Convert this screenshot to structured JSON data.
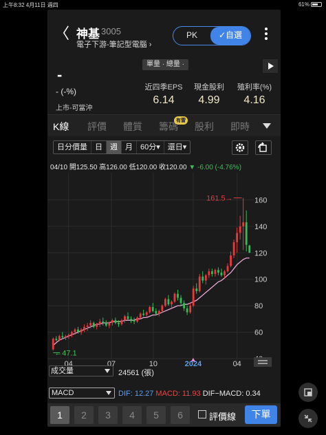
{
  "status": {
    "time_date": "上午8:32  4月11日 週四",
    "wifi_battery": "61%"
  },
  "header": {
    "back": "〈",
    "name": "神基",
    "code": "3005",
    "category": "電子下游-筆記型電腦 ›",
    "pk": "PK",
    "fav": "✓自選"
  },
  "quote": {
    "toggle": "單量 · 總量 ·",
    "price": "-",
    "change": "- (-%)",
    "market": "上市-可當沖",
    "stats": [
      {
        "label": "近四季EPS",
        "value": "6.14"
      },
      {
        "label": "現金股利",
        "value": "4.99"
      },
      {
        "label": "殖利率(%)",
        "value": "4.16"
      }
    ]
  },
  "tabs": {
    "items": [
      "K線",
      "評價",
      "體質",
      "籌碼",
      "股利",
      "即時"
    ],
    "badge": "有雷"
  },
  "toolbar": {
    "segments": [
      "日分價量",
      "日",
      "週",
      "月",
      "60分▾",
      "還日▾"
    ],
    "active": "週"
  },
  "ohlc": {
    "date": "04/10",
    "open": "開125.50",
    "high": "高126.00",
    "low": "低120.00",
    "close": "收120.00",
    "change": "▼ -6.00 (-4.76%)"
  },
  "chart_data": {
    "type": "candlestick",
    "y_ticks": [
      "160",
      "140",
      "120",
      "100",
      "80",
      "60",
      "40"
    ],
    "x_ticks": [
      "04",
      "07",
      "10",
      "2024",
      "04"
    ],
    "annot_high": "161.5",
    "annot_low": "47.1",
    "ylim": [
      40,
      168
    ],
    "candles": [
      [
        47,
        56,
        46,
        55
      ],
      [
        55,
        57,
        53,
        54
      ],
      [
        54,
        58,
        53,
        57
      ],
      [
        57,
        60,
        55,
        56
      ],
      [
        56,
        58,
        54,
        57
      ],
      [
        57,
        59,
        55,
        58
      ],
      [
        58,
        61,
        56,
        60
      ],
      [
        60,
        63,
        58,
        62
      ],
      [
        62,
        64,
        59,
        60
      ],
      [
        60,
        63,
        58,
        62
      ],
      [
        62,
        66,
        60,
        64
      ],
      [
        64,
        67,
        61,
        65
      ],
      [
        65,
        69,
        63,
        67
      ],
      [
        67,
        68,
        63,
        64
      ],
      [
        64,
        67,
        62,
        66
      ],
      [
        66,
        70,
        64,
        68
      ],
      [
        68,
        71,
        65,
        67
      ],
      [
        67,
        69,
        64,
        65
      ],
      [
        65,
        68,
        63,
        67
      ],
      [
        67,
        70,
        65,
        69
      ],
      [
        69,
        71,
        66,
        67
      ],
      [
        67,
        69,
        64,
        66
      ],
      [
        66,
        70,
        65,
        69
      ],
      [
        69,
        73,
        67,
        72
      ],
      [
        72,
        75,
        69,
        70
      ],
      [
        70,
        72,
        67,
        69
      ],
      [
        69,
        71,
        66,
        68
      ],
      [
        68,
        72,
        67,
        71
      ],
      [
        71,
        75,
        70,
        74
      ],
      [
        74,
        77,
        72,
        73
      ],
      [
        73,
        76,
        71,
        75
      ],
      [
        75,
        80,
        74,
        79
      ],
      [
        79,
        82,
        75,
        76
      ],
      [
        76,
        78,
        73,
        74
      ],
      [
        74,
        77,
        72,
        76
      ],
      [
        76,
        81,
        75,
        80
      ],
      [
        80,
        86,
        79,
        85
      ],
      [
        85,
        88,
        80,
        81
      ],
      [
        81,
        84,
        78,
        83
      ],
      [
        83,
        90,
        82,
        89
      ],
      [
        89,
        92,
        84,
        86
      ],
      [
        86,
        88,
        80,
        82
      ],
      [
        82,
        84,
        76,
        78
      ],
      [
        78,
        80,
        73,
        75
      ],
      [
        75,
        82,
        74,
        80
      ],
      [
        80,
        95,
        79,
        93
      ],
      [
        93,
        97,
        89,
        91
      ],
      [
        91,
        104,
        90,
        102
      ],
      [
        102,
        106,
        97,
        99
      ],
      [
        99,
        104,
        96,
        103
      ],
      [
        103,
        108,
        101,
        106
      ],
      [
        106,
        108,
        102,
        104
      ],
      [
        104,
        108,
        102,
        107
      ],
      [
        107,
        109,
        103,
        105
      ],
      [
        105,
        108,
        102,
        103
      ],
      [
        103,
        107,
        101,
        106
      ],
      [
        106,
        112,
        105,
        110
      ],
      [
        110,
        121,
        109,
        118
      ],
      [
        118,
        130,
        116,
        128
      ],
      [
        128,
        139,
        120,
        135
      ],
      [
        135,
        148,
        130,
        140
      ],
      [
        140,
        161.5,
        122,
        143
      ],
      [
        143,
        152,
        121,
        126
      ],
      [
        125.5,
        126,
        120,
        120
      ]
    ],
    "ma": [
      50,
      52,
      54,
      55,
      56,
      57,
      58,
      59,
      60,
      61,
      62,
      63,
      64,
      65,
      66,
      66,
      67,
      67,
      67,
      68,
      68,
      68,
      68,
      69,
      69,
      69,
      69,
      70,
      70,
      71,
      71,
      72,
      73,
      73,
      74,
      75,
      76,
      77,
      78,
      79,
      80,
      80,
      81,
      81,
      82,
      83,
      84,
      86,
      88,
      90,
      92,
      94,
      96,
      98,
      99,
      101,
      103,
      105,
      108,
      111,
      113,
      115,
      116,
      116
    ]
  },
  "volume": {
    "select": "成交量",
    "value": "24561 (張)"
  },
  "macd": {
    "select": "MACD",
    "dif": "DIF: 12.27",
    "macd": "MACD: 11.93",
    "diff": "DIF−MACD: 0.34"
  },
  "bottom": {
    "nums": [
      "1",
      "2",
      "3",
      "4",
      "5",
      "6"
    ],
    "checkbox": "評價線",
    "order": "下單"
  }
}
